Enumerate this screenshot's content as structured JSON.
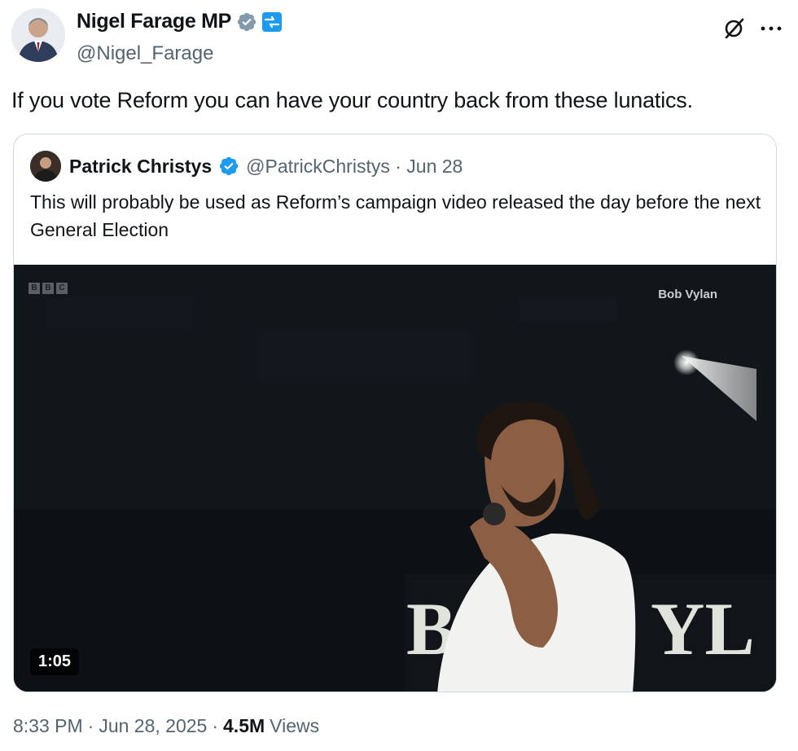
{
  "author": {
    "display_name": "Nigel Farage MP",
    "handle": "@Nigel_Farage",
    "verified_color": "#829aab",
    "affiliate_color": "#1d9bf0"
  },
  "tweet": {
    "text": "If you vote Reform you can have your country back from these lunatics."
  },
  "quoted": {
    "display_name": "Patrick Christys",
    "handle_date": "@PatrickChristys · Jun 28",
    "verified_color": "#1d9bf0",
    "text": "This will probably be used as Reform’s campaign video released the day before the next General Election",
    "video": {
      "duration": "1:05",
      "overlay_label": "Bob Vylan",
      "broadcaster_logo": [
        "B",
        "B",
        "C"
      ]
    }
  },
  "footer": {
    "time": "8:33 PM",
    "sep1": "·",
    "date": "Jun 28, 2025",
    "sep2": "·",
    "views_count": "4.5M",
    "views_label": "Views"
  },
  "icons": {
    "grok": "grok-icon",
    "more": "more-options-icon"
  }
}
